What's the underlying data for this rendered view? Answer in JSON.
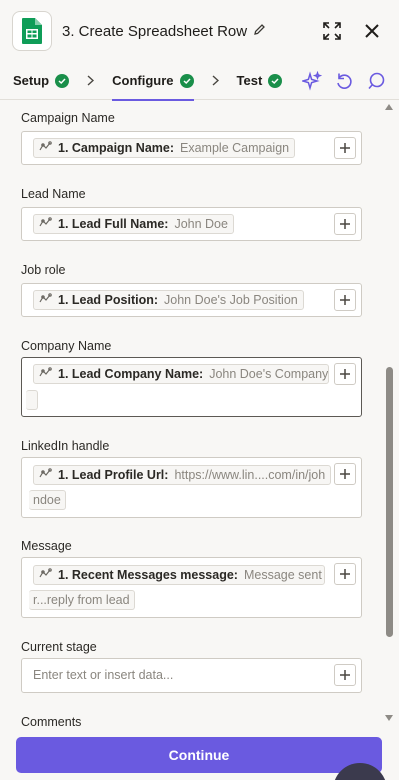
{
  "header": {
    "title": "3. Create Spreadsheet Row",
    "app_icon": "google-sheets-icon",
    "edit_icon": "pencil-icon",
    "expand_icon": "expand-icon",
    "close_icon": "close-icon"
  },
  "tabs": [
    {
      "label": "Setup",
      "status": "complete"
    },
    {
      "label": "Configure",
      "status": "complete",
      "active": true
    },
    {
      "label": "Test",
      "status": "complete"
    }
  ],
  "toolbar_icons": [
    "ai-sparkle-icon",
    "undo-icon",
    "comment-icon"
  ],
  "fields": [
    {
      "label": "Campaign Name",
      "pill_key": "1. Campaign Name:",
      "pill_value": "Example Campaign"
    },
    {
      "label": "Lead Name",
      "pill_key": "1. Lead Full Name:",
      "pill_value": "John Doe"
    },
    {
      "label": "Job role",
      "pill_key": "1. Lead Position:",
      "pill_value": "John Doe's Job Position"
    },
    {
      "label": "Company Name",
      "pill_key": "1. Lead Company Name:",
      "pill_value": "John Doe's Company"
    },
    {
      "label": "LinkedIn handle",
      "pill_key": "1. Lead Profile Url:",
      "pill_value": "https://www.lin....com/in/joh",
      "pill_value_cont": "ndoe"
    },
    {
      "label": "Message",
      "pill_key": "1. Recent Messages message:",
      "pill_value": "Message sent f",
      "pill_value_cont": "r...reply from lead"
    },
    {
      "label": "Current stage",
      "placeholder": "Enter text or insert data..."
    },
    {
      "label": "Comments"
    }
  ],
  "footer": {
    "continue_label": "Continue"
  },
  "colors": {
    "accent": "#6a5ae0",
    "success": "#1a8f4a",
    "sheets_green": "#0f9d58"
  }
}
